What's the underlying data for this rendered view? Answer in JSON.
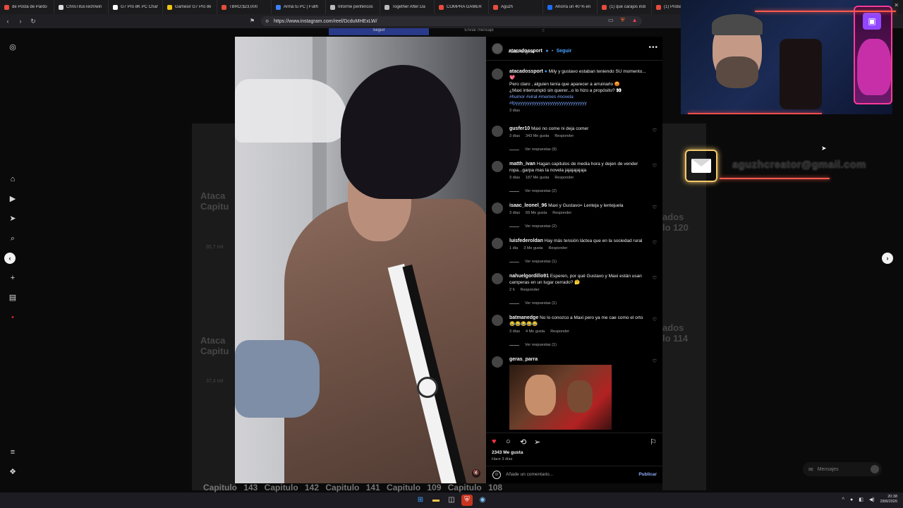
{
  "browser": {
    "tabs": [
      {
        "title": "de Posta de Pardo",
        "color": "#e74c3c"
      },
      {
        "title": "ChrisTitusTech/win",
        "color": "#dddddd"
      },
      {
        "title": "G7 Pro 8K PC Cham",
        "color": "#ffffff"
      },
      {
        "title": "Gamesir G7 Pro 8k",
        "color": "#f1c40f"
      },
      {
        "title": "TBRO;$23,000",
        "color": "#e74c3c"
      },
      {
        "title": "Armá tu PC | Fullh",
        "color": "#3b82f6"
      },
      {
        "title": "Informe periféricos",
        "color": "#bbbbbb"
      },
      {
        "title": "Together After Da",
        "color": "#bbbbbb"
      },
      {
        "title": "COMPRA GAMER",
        "color": "#e74c3c"
      },
      {
        "title": "Aguzh",
        "color": "#e74c3c"
      },
      {
        "title": "Ahorra un 40 % en",
        "color": "#1b6ef3"
      },
      {
        "title": "(1) que carajos indi",
        "color": "#e74c3c"
      },
      {
        "title": "(1) Probando la CD",
        "color": "#e74c3c"
      },
      {
        "title": "(1) Tattad Tattad",
        "color": "#e74c3c"
      },
      {
        "title": "Instagram",
        "color": "#e1306c",
        "active": true
      }
    ],
    "new_tab": "+",
    "url": "https://www.instagram.com/reel/DcduMHExLW/"
  },
  "ig": {
    "top_strip": [
      "Seguir",
      "Enviar mensaje",
      "⁝⁝"
    ],
    "bg_labels": {
      "left1": "Ataca\nCapitu",
      "left1_views": "35,7 mil",
      "left2": "Ataca\nCapitu",
      "left2_views": "37,4 mil",
      "right1": "ados\nlo 120",
      "right2": "ados\nlo 114",
      "bottom": "Capitulo 143   Capitulo 142   Capitulo 141   Capitulo 109   Capitulo 108"
    },
    "post": {
      "author": "atacadossport",
      "verified": "●",
      "dot": "•",
      "follow": "Seguir",
      "audio": "Audio original",
      "more": "•••",
      "caption_user": "atacadossport",
      "caption": "Mily y gustavo estaban teniendo SU momento...💖",
      "caption2": "Pero claro , alguien tenía que aparecer a arruinarlo 😡",
      "caption3": "¿Maxi interrumpió sin querer...o lo hizo a propósito? 👀",
      "tags": "#humor #viral #memes #novela",
      "tags2": "#fpyyyyyyyyyyyyyyyyyyyyyyyyyyyyyyy",
      "caption_time": "3 días",
      "likes": "2343 Me gusta",
      "when": "Hace 3 días",
      "comment_placeholder": "Añade un comentario...",
      "publish": "Publicar"
    },
    "comments": [
      {
        "user": "gusfer10",
        "text": "Maxi no come ni deja comer",
        "time": "3 días",
        "likes": "343 Me gusta",
        "reply": "Responder",
        "replies": "Ver respuestas (9)"
      },
      {
        "user": "matth_ivan",
        "text": "Hagan capitulos de media hora y dejen de vender ropa...garpa mas la novela jajajajajaja",
        "time": "3 días",
        "likes": "187 Me gusta",
        "reply": "Responder",
        "replies": "Ver respuestas (2)"
      },
      {
        "user": "isaac_leonel_96",
        "text": "Maxi y Gustavo= Lenteja y lentejuela",
        "time": "3 días",
        "likes": "69 Me gusta",
        "reply": "Responder",
        "replies": "Ver respuestas (2)"
      },
      {
        "user": "luisfederoldan",
        "text": "Hay más tensión láctea que en la sociedad rural",
        "time": "1 día",
        "likes": "3 Me gusta",
        "reply": "Responder",
        "replies": "Ver respuestas (1)"
      },
      {
        "user": "nahuelgordillo91",
        "text": "Esperen, por qué Gustavo y Maxi están usan camperas en un lugar cerrado? 🤔",
        "time": "2 h",
        "likes": "",
        "reply": "Responder",
        "replies": "Ver respuestas (1)"
      },
      {
        "user": "batmanedge",
        "text": "No lo conozco a Maxi pero ya me cae como el orto😂😂😂😂😂",
        "time": "3 días",
        "likes": "4 Me gusta",
        "reply": "Responder",
        "replies": "Ver respuestas (1)"
      },
      {
        "user": "geras_parra",
        "text": "",
        "time": "",
        "likes": "",
        "reply": "",
        "replies": ""
      }
    ],
    "messages": "Mensajes"
  },
  "overlay": {
    "email": "aguzhcreator@gmail.com"
  },
  "taskbar": {
    "time": "20:38",
    "date": "28/8/2026"
  }
}
